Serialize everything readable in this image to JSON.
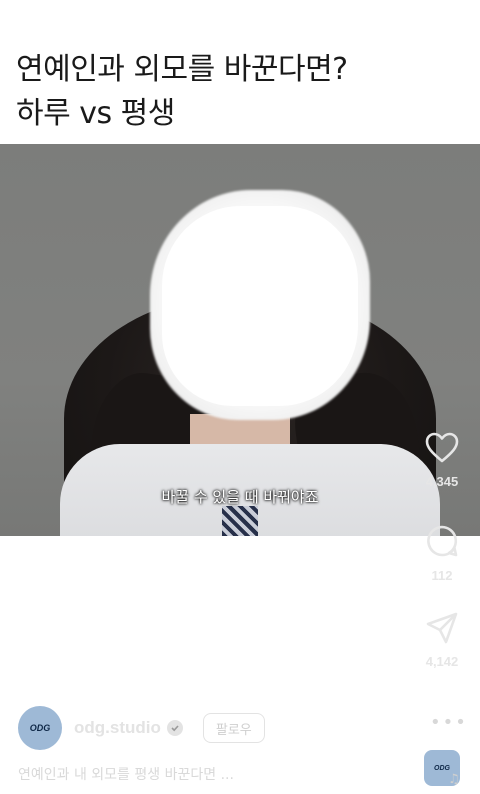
{
  "post": {
    "title_line1": "연예인과 외모를 바꾼다면?",
    "title_line2": "하루 vs 평생"
  },
  "video": {
    "subtitle": "바꿀 수 있을 때 바꿔야죠"
  },
  "actions": {
    "like_count": "4,345",
    "comment_count": "112",
    "share_count": "4,142",
    "like_icon": "heart-icon",
    "comment_icon": "comment-icon",
    "share_icon": "send-icon",
    "more_icon": "more-dots-icon"
  },
  "profile": {
    "avatar_text": "ODG",
    "username": "odg.studio",
    "follow_label": "팔로우"
  },
  "caption": "연예인과 내 외모를 평생 바꾼다면 ...",
  "audio": {
    "thumb_text": "ODG",
    "icon": "music-note-icon"
  },
  "colors": {
    "avatar_bg": "#9eb9d6",
    "overlay_text": "#e3e3e3"
  }
}
